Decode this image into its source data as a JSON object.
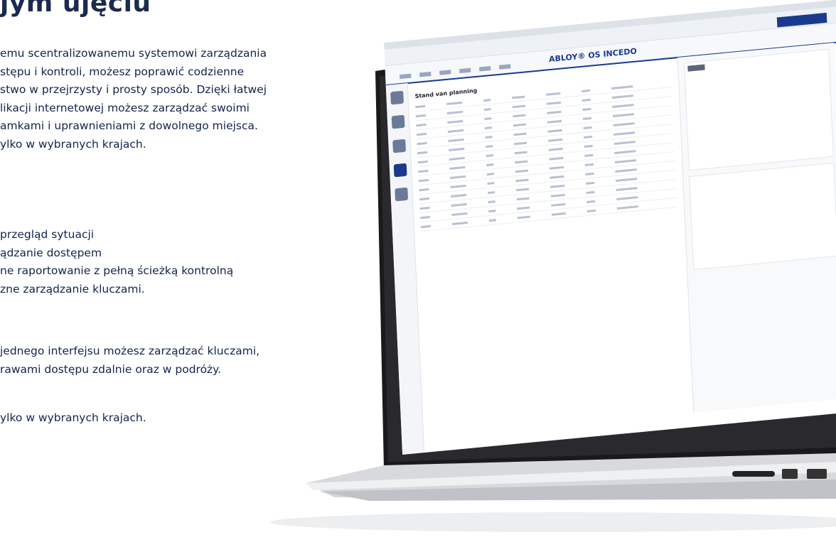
{
  "heading": "jym ujęciu",
  "intro_lines": [
    "emu scentralizowanemu systemowi zarządzania",
    "stępu i kontroli, możesz poprawić codzienne",
    "stwo w przejrzysty i prosty sposób. Dzięki łatwej",
    "likacji internetowej możesz zarządzać swoimi",
    "amkami i uprawnieniami z dowolnego miejsca.",
    "ylko w wybranych krajach."
  ],
  "features": [
    "przegląd sytuacji",
    "ądzanie dostępem",
    "ne raportowanie z pełną ścieżką kontrolną",
    "zne zarządzanie kluczami."
  ],
  "closing_lines": [
    "jednego interfejsu możesz zarządzać kluczami,",
    "rawami dostępu zdalnie oraz w podróży."
  ],
  "footnote": "ylko w wybranych krajach.",
  "app": {
    "brand": "ABLOY® OS INCEDO",
    "table_title": "Stand van planning",
    "rows": 14
  }
}
